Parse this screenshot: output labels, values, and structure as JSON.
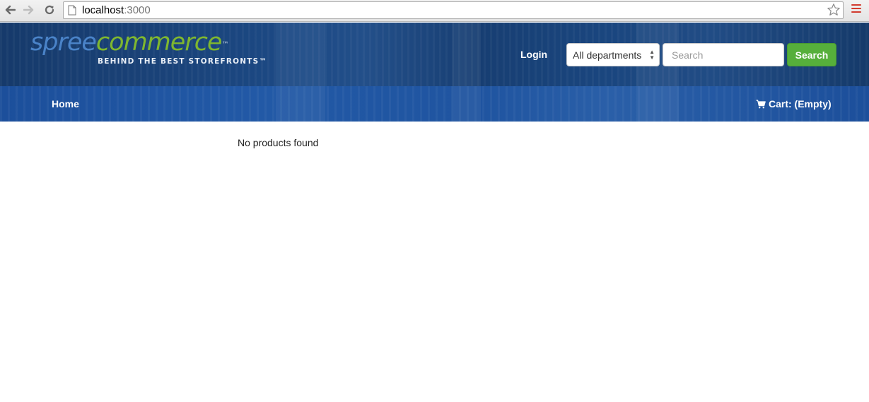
{
  "browser": {
    "url_host": "localhost",
    "url_port": ":3000",
    "icons": {
      "back": "arrow-left-icon",
      "forward": "arrow-right-icon",
      "reload": "reload-icon",
      "page": "page-icon",
      "bookmark": "star-icon",
      "menu": "menu-icon"
    },
    "colors": {
      "menu_icon": "#d23b2f"
    }
  },
  "header": {
    "logo": {
      "word1": "spree",
      "word2": "commerce",
      "tm": "™",
      "tagline": "BEHIND THE BEST STOREFRONTS™"
    },
    "login_label": "Login",
    "department_select": {
      "selected": "All departments"
    },
    "search": {
      "placeholder": "Search",
      "value": "",
      "button_label": "Search"
    },
    "colors": {
      "search_button": "#56af3b",
      "header_blue": "#1d4d8e",
      "logo_spree": "#4a83c8",
      "logo_commerce": "#7fb72f"
    }
  },
  "nav": {
    "home_label": "Home",
    "cart_label": "Cart: (Empty)",
    "cart_icon": "shopping-cart-icon"
  },
  "main": {
    "empty_message": "No products found"
  }
}
